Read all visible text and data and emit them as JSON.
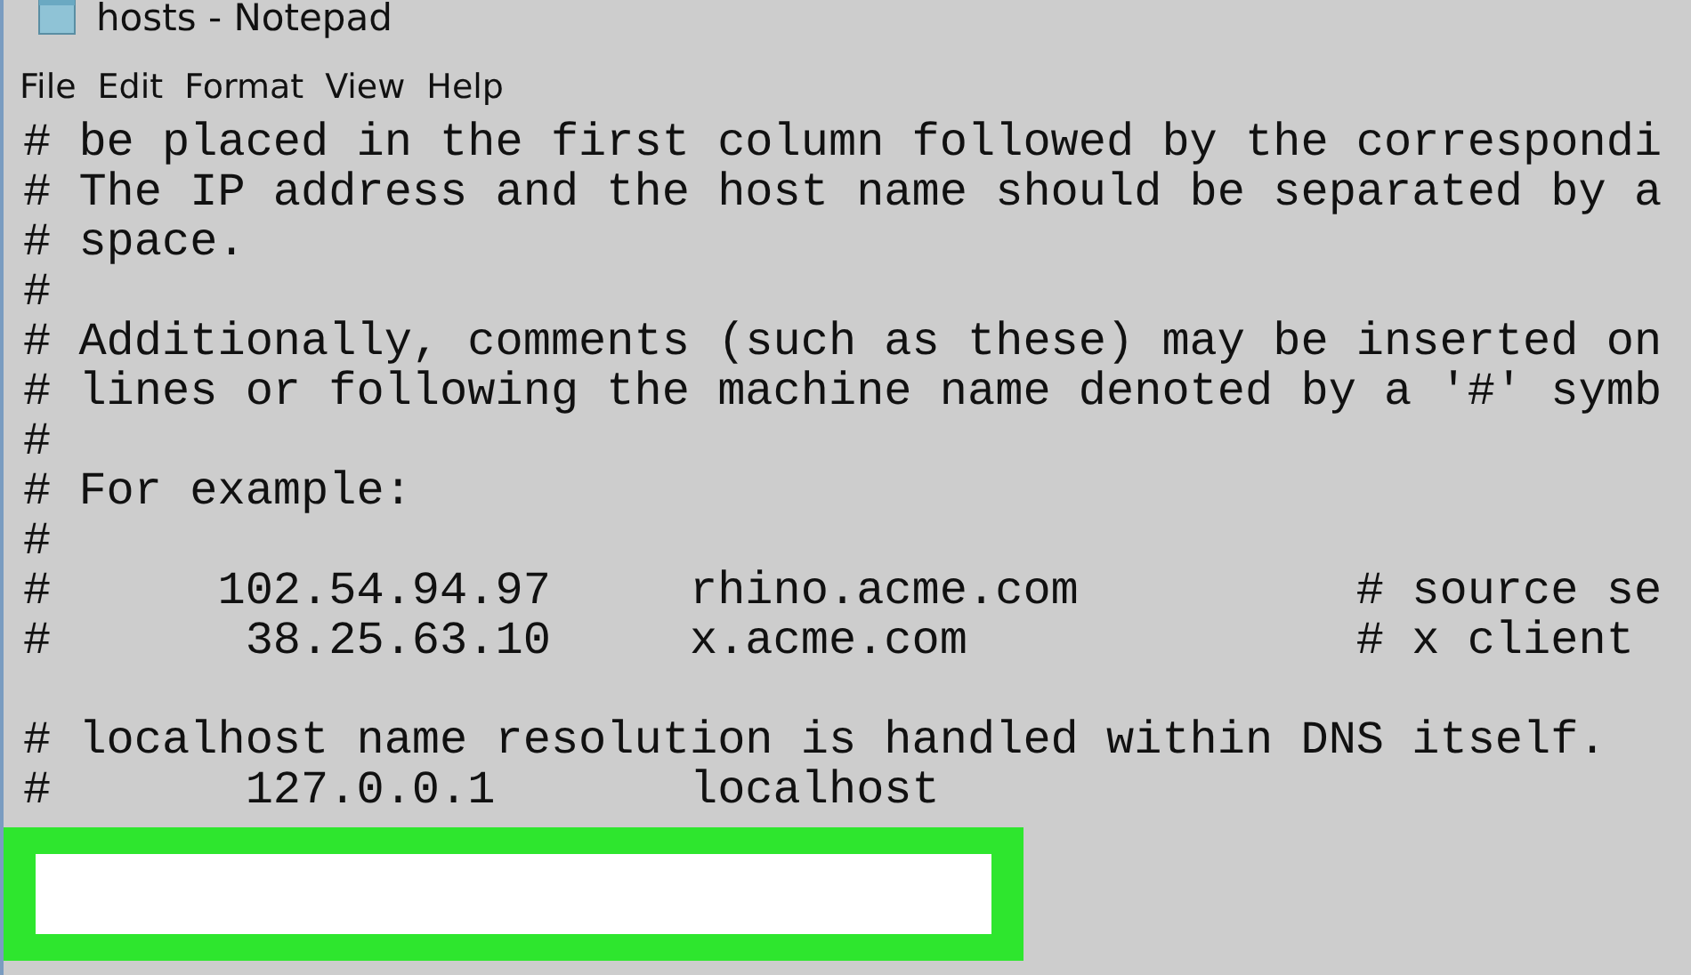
{
  "window": {
    "title": "hosts - Notepad"
  },
  "menu": [
    "File",
    "Edit",
    "Format",
    "View",
    "Help"
  ],
  "editor": {
    "lines": [
      {
        "kind": "text",
        "text": "# be placed in the first column followed by the correspondi"
      },
      {
        "kind": "text",
        "text": "# The IP address and the host name should be separated by a"
      },
      {
        "kind": "text",
        "text": "# space."
      },
      {
        "kind": "text",
        "text": "#"
      },
      {
        "kind": "text",
        "text": "# Additionally, comments (such as these) may be inserted on"
      },
      {
        "kind": "text",
        "text": "# lines or following the machine name denoted by a '#' symb"
      },
      {
        "kind": "text",
        "text": "#"
      },
      {
        "kind": "text",
        "text": "# For example:"
      },
      {
        "kind": "text",
        "text": "#"
      },
      {
        "kind": "text",
        "text": "#      102.54.94.97     rhino.acme.com          # source se"
      },
      {
        "kind": "text",
        "text": "#       38.25.63.10     x.acme.com              # x client"
      },
      {
        "kind": "blank"
      },
      {
        "kind": "text",
        "text": "# localhost name resolution is handled within DNS itself."
      },
      {
        "kind": "text",
        "text": "#       127.0.0.1       localhost"
      }
    ]
  }
}
